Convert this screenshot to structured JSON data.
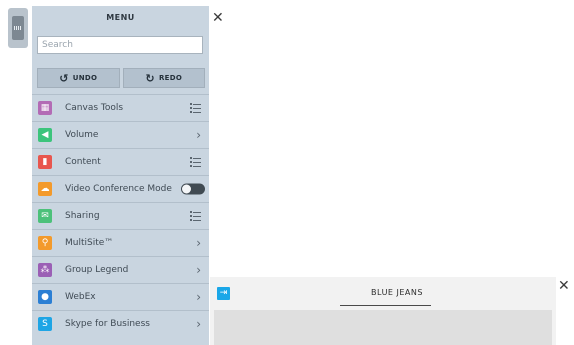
{
  "menu": {
    "title": "MENU",
    "search_placeholder": "Search",
    "undo_label": "UNDO",
    "redo_label": "REDO",
    "items": [
      {
        "label": "Canvas Tools",
        "icon": "canvas-tools-icon",
        "color": "#b36bb5",
        "trailing": "list"
      },
      {
        "label": "Volume",
        "icon": "volume-icon",
        "color": "#3cc47c",
        "trailing": "chevron"
      },
      {
        "label": "Content",
        "icon": "content-icon",
        "color": "#e8564e",
        "trailing": "list"
      },
      {
        "label": "Video Conference Mode",
        "icon": "cloud-icon",
        "color": "#f39a2b",
        "trailing": "toggle",
        "toggle_on": false
      },
      {
        "label": "Sharing",
        "icon": "sharing-icon",
        "color": "#4cc17a",
        "trailing": "list"
      },
      {
        "label": "MultiSite™",
        "icon": "multisite-icon",
        "color": "#f39a2b",
        "trailing": "chevron"
      },
      {
        "label": "Group Legend",
        "icon": "group-legend-icon",
        "color": "#9b5fb5",
        "trailing": "chevron"
      },
      {
        "label": "WebEx",
        "icon": "webex-icon",
        "color": "#2b7fd4",
        "trailing": "chevron"
      },
      {
        "label": "Skype for Business",
        "icon": "skype-icon",
        "color": "#1ea5e5",
        "trailing": "chevron"
      }
    ]
  },
  "blue_jeans": {
    "title": "BLUE JEANS",
    "icon": "exit-icon",
    "accent_color": "#1aa7e8"
  },
  "icons": {
    "grip": "drag-handle-icon",
    "close": "close-icon",
    "undo": "undo-icon",
    "redo": "redo-icon",
    "chevron": "chevron-right-icon",
    "list": "list-icon"
  }
}
